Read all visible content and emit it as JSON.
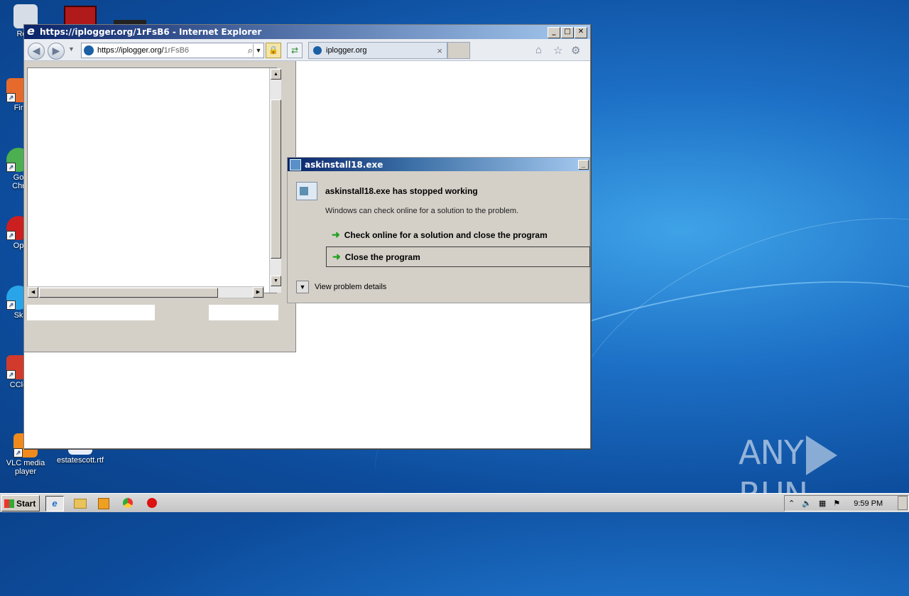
{
  "desktop": {
    "icons": [
      {
        "label": "Recy",
        "color": "#d7dde6"
      },
      {
        "label": "Fir",
        "color": "#e66a2c"
      },
      {
        "label": "Go\nChr",
        "color": "#4caf50"
      },
      {
        "label": "Op",
        "color": "#cc1f1f"
      },
      {
        "label": "Sk",
        "color": "#2aa4e8"
      },
      {
        "label": "CCle",
        "color": "#d23b2b"
      },
      {
        "label": "VLC media\nplayer",
        "color": "#f08a1c"
      },
      {
        "label": "estatescott.rtf",
        "color": "#e8eef8"
      }
    ],
    "watermark": {
      "left": "ANY",
      "right": "RUN"
    }
  },
  "ie": {
    "title": "https://iplogger.org/1rFsB6 - Internet Explorer",
    "address_scheme": "https://iplogger.org/",
    "address_path": "1rFsB6",
    "tab_label": "iplogger.org",
    "tab_close": "×",
    "buttons": {
      "min": "_",
      "max": "□",
      "close": "✕"
    },
    "icons": {
      "back": "back-icon",
      "forward": "forward-icon",
      "home": "home-icon",
      "favorites": "favorites-icon",
      "tools": "gear-icon"
    }
  },
  "dialog": {
    "title": "askinstall18.exe",
    "heading": "askinstall18.exe has stopped working",
    "subtext": "Windows can check online for a solution to the problem.",
    "option_check": "Check online for a solution and close the program",
    "option_close": "Close the program",
    "details": "View problem details",
    "min_label": "_"
  },
  "taskbar": {
    "start_label": "Start",
    "clock": "9:59 PM",
    "pinned": [
      "ie-icon",
      "explorer-icon",
      "media-player-icon",
      "chrome-icon",
      "opera-icon"
    ]
  },
  "colors": {
    "title_bar": "#0a246a",
    "arrow_green": "#20a020"
  }
}
